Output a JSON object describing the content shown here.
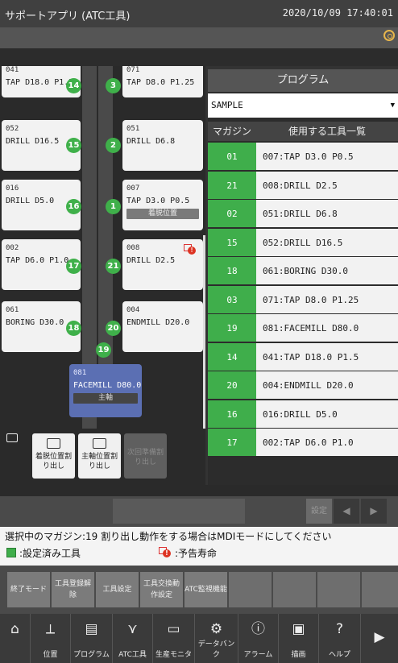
{
  "header": {
    "title": "サポートアプリ (ATC工具)",
    "datetime": "2020/10/09 17:40:01"
  },
  "magazine": {
    "cards": [
      {
        "num": "041",
        "tool": "TAP D18.0 P1.5",
        "status": ""
      },
      {
        "num": "071",
        "tool": "TAP D8.0 P1.25",
        "status": ""
      },
      {
        "num": "052",
        "tool": "DRILL D16.5",
        "status": ""
      },
      {
        "num": "051",
        "tool": "DRILL D6.8",
        "status": ""
      },
      {
        "num": "016",
        "tool": "DRILL D5.0",
        "status": ""
      },
      {
        "num": "007",
        "tool": "TAP D3.0 P0.5",
        "status": "着脱位置"
      },
      {
        "num": "002",
        "tool": "TAP D6.0 P1.0",
        "status": ""
      },
      {
        "num": "008",
        "tool": "DRILL D2.5",
        "status": ""
      },
      {
        "num": "061",
        "tool": "BORING D30.0",
        "status": ""
      },
      {
        "num": "004",
        "tool": "ENDMILL D20.0",
        "status": ""
      },
      {
        "num": "081",
        "tool": "FACEMILL D80.0",
        "status": "主軸"
      }
    ],
    "pots": [
      "14",
      "3",
      "15",
      "2",
      "16",
      "1",
      "17",
      "21",
      "18",
      "20",
      "19"
    ],
    "buttons": [
      {
        "label": "着脱位置割り出し",
        "enabled": true
      },
      {
        "label": "主軸位置割り出し",
        "enabled": true
      },
      {
        "label": "次回準備割り出し",
        "enabled": false
      }
    ]
  },
  "program": {
    "title": "プログラム",
    "selected": "SAMPLE",
    "col_magazine": "マガジン",
    "col_tools": "使用する工具一覧",
    "rows": [
      {
        "mag": "01",
        "tool": "007:TAP D3.0 P0.5"
      },
      {
        "mag": "21",
        "tool": "008:DRILL D2.5"
      },
      {
        "mag": "02",
        "tool": "051:DRILL D6.8"
      },
      {
        "mag": "15",
        "tool": "052:DRILL D16.5"
      },
      {
        "mag": "18",
        "tool": "061:BORING D30.0"
      },
      {
        "mag": "03",
        "tool": "071:TAP D8.0 P1.25"
      },
      {
        "mag": "19",
        "tool": "081:FACEMILL D80.0"
      },
      {
        "mag": "14",
        "tool": "041:TAP D18.0 P1.5"
      },
      {
        "mag": "20",
        "tool": "004:ENDMILL D20.0"
      },
      {
        "mag": "16",
        "tool": "016:DRILL D5.0"
      },
      {
        "mag": "17",
        "tool": "002:TAP D6.0 P1.0"
      }
    ]
  },
  "control": {
    "set_label": "設定"
  },
  "message": {
    "line1": "選択中のマガジン:19 割り出し動作をする場合はMDIモードにしてください",
    "legend_set": ":設定済み工具",
    "legend_warn": ":予告寿命"
  },
  "function_keys": [
    "終了モード",
    "工具登録解除",
    "工具設定",
    "工具交換動作設定",
    "ATC監視機能",
    "",
    "",
    "",
    ""
  ],
  "nav": [
    {
      "label": "",
      "icon": "home-icon"
    },
    {
      "label": "位置",
      "icon": "axis-icon"
    },
    {
      "label": "プログラム",
      "icon": "program-icon"
    },
    {
      "label": "ATC工具",
      "icon": "atc-tool-icon"
    },
    {
      "label": "生産モニタ",
      "icon": "monitor-icon"
    },
    {
      "label": "データバンク",
      "icon": "gear-icon"
    },
    {
      "label": "アラーム",
      "icon": "alarm-icon"
    },
    {
      "label": "描画",
      "icon": "cube-icon"
    },
    {
      "label": "ヘルプ",
      "icon": "help-icon"
    }
  ],
  "colors": {
    "accent_green": "#3fae4b",
    "spindle_blue": "#5b6fb3"
  }
}
